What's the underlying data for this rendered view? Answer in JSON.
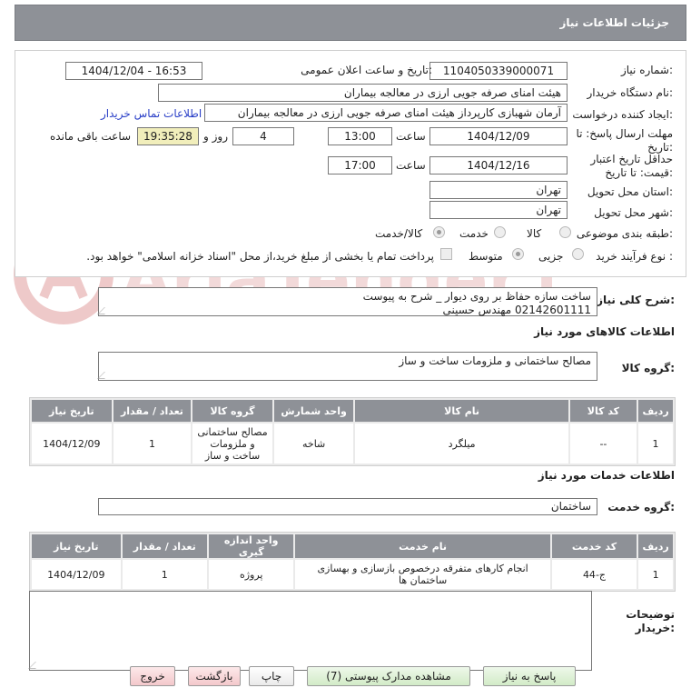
{
  "header": {
    "title": "جزئیات اطلاعات نیاز"
  },
  "form": {
    "need_number_label": "شماره نیاز:",
    "need_number": "1104050339000071",
    "announce_label": "تاریخ و ساعت اعلان عمومی:",
    "announce_value": "1404/12/04 - 16:53",
    "buyer_org_label": "نام دستگاه خریدار:",
    "buyer_org": "هیئت امنای صرفه جویی ارزی در معالجه بیماران",
    "requester_label": "ایجاد کننده درخواست:",
    "requester": "آرمان شهبازی کارپرداز هیئت امنای صرفه جویی ارزی در معالجه بیماران",
    "contact_link": "اطلاعات تماس خریدار",
    "deadline_label_1": "مهلت ارسال پاسخ: تا",
    "deadline_label_2": "تاریخ:",
    "deadline_date": "1404/12/09",
    "time_label": "ساعت",
    "deadline_time": "13:00",
    "days_value": "4",
    "days_label": "روز و",
    "remaining_time": "19:35:28",
    "remaining_label": "ساعت باقی مانده",
    "validity_label_1": "حداقل تاریخ اعتبار",
    "validity_label_2": "قیمت: تا تاریخ:",
    "validity_date": "1404/12/16",
    "validity_time": "17:00",
    "province_label": "استان محل تحویل:",
    "province": "تهران",
    "city_label": "شهر محل تحویل:",
    "city": "تهران",
    "category_label": "طبقه بندی موضوعی:",
    "category_options": [
      "کالا",
      "خدمت",
      "کالا/خدمت"
    ],
    "process_label": "نوع فرآیند خرید :",
    "process_options": [
      "جزیی",
      "متوسط"
    ],
    "payment_text": "پرداخت تمام یا بخشی از مبلغ خرید،از محل \"اسناد خزانه اسلامی\" خواهد بود."
  },
  "description": {
    "label": "شرح کلی نیاز:",
    "line1": "ساخت سازه حفاظ بر روی دیوار _ شرح به پیوست",
    "line2": "02142601111 مهندس حسینی"
  },
  "goods": {
    "section_title": "اطلاعات کالاهای مورد نیاز",
    "group_label": "گروه کالا:",
    "group_value": "مصالح ساختمانی و ملزومات ساخت و ساز",
    "headers": [
      "ردیف",
      "کد کالا",
      "نام کالا",
      "واحد شمارش",
      "گروه کالا",
      "تعداد / مقدار",
      "تاریخ نیاز"
    ],
    "rows": [
      {
        "row": "1",
        "code": "--",
        "name": "میلگرد",
        "unit": "شاخه",
        "group": "مصالح ساختمانی و ملزومات ساخت و ساز",
        "qty": "1",
        "date": "1404/12/09"
      }
    ]
  },
  "services": {
    "section_title": "اطلاعات خدمات مورد نیاز",
    "group_label": "گروه خدمت:",
    "group_value": "ساختمان",
    "headers": [
      "ردیف",
      "کد خدمت",
      "نام خدمت",
      "واحد اندازه گیری",
      "تعداد / مقدار",
      "تاریخ نیاز"
    ],
    "rows": [
      {
        "row": "1",
        "code": "ج-44",
        "name": "انجام کارهای متفرقه درخصوص بازسازی و بهسازی ساختمان ها",
        "unit": "پروژه",
        "qty": "1",
        "date": "1404/12/09"
      }
    ]
  },
  "buyer_notes": {
    "label_1": "توضیحات",
    "label_2": "خریدار:"
  },
  "buttons": {
    "reply": "پاسخ به نیاز",
    "attachments": "مشاهده مدارک پیوستی (7)",
    "print": "چاپ",
    "back": "بازگشت",
    "exit": "خروج"
  },
  "watermark": {
    "text": "AriaTender.neT"
  },
  "colors": {
    "header_bg": "#8e9197",
    "highlight": "#f1eebb",
    "link": "#2a3fc7",
    "watermark": "#e9b9b9"
  }
}
